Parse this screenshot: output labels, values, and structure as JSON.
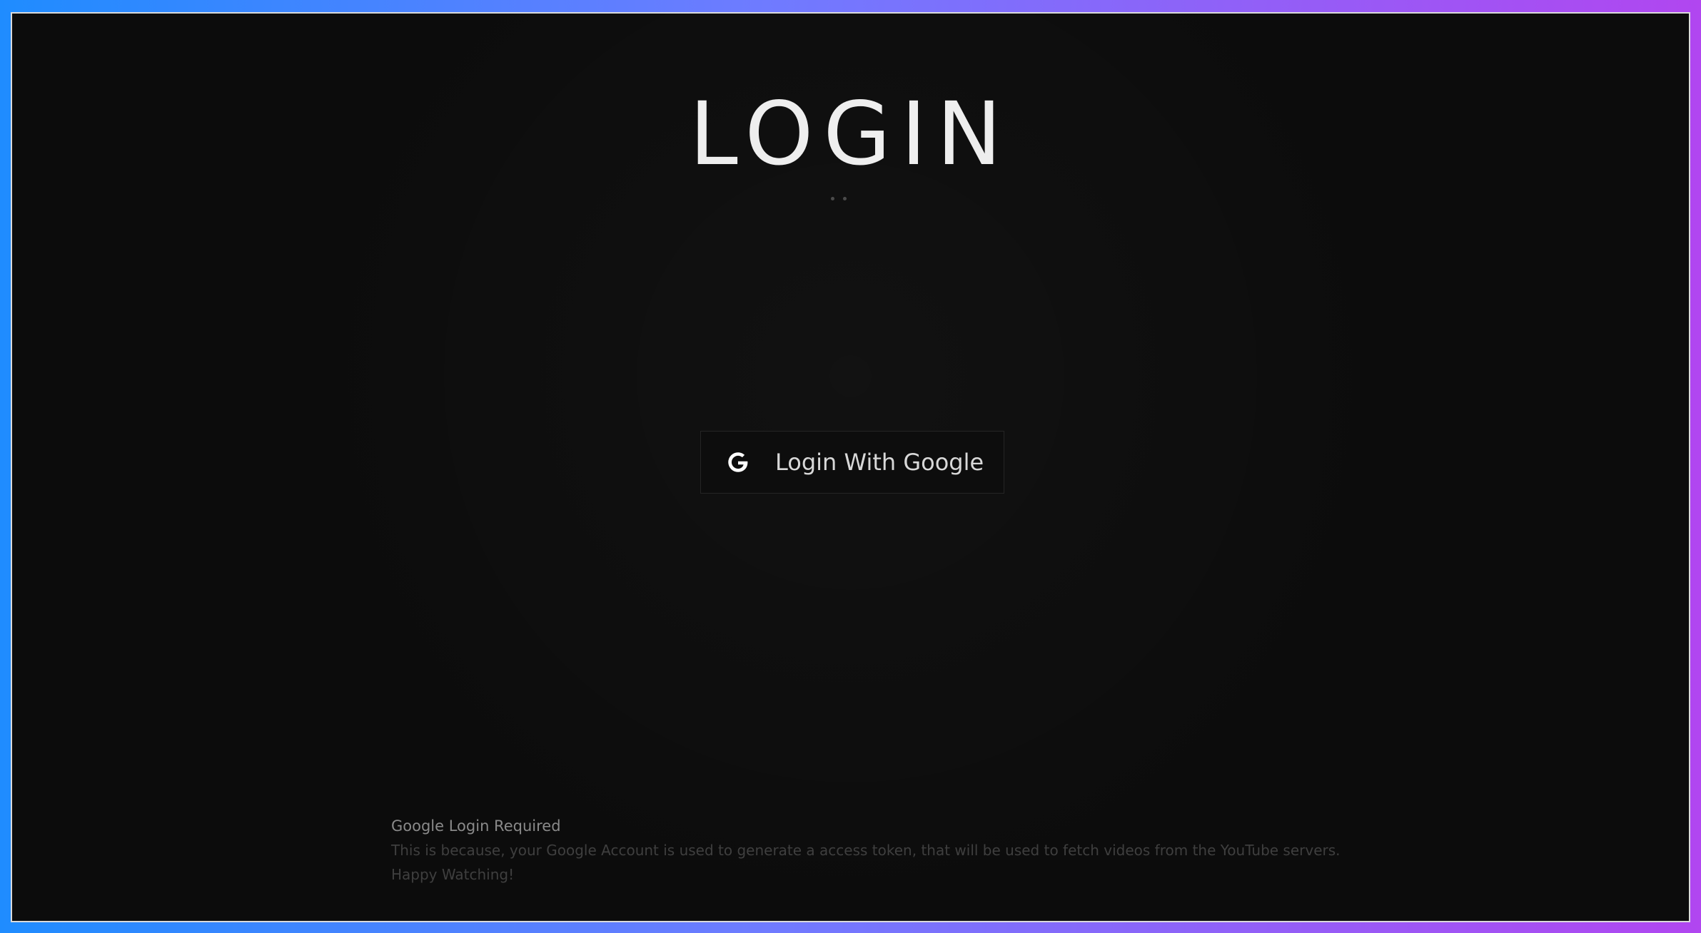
{
  "page": {
    "title": "LOGIN"
  },
  "login_button": {
    "label": "Login With Google",
    "icon": "google-g-icon"
  },
  "notice": {
    "heading": "Google Login Required",
    "body": "This is because, your Google Account is used to generate a access token, that will be used to fetch videos from the YouTube servers.",
    "closing": "Happy Watching!"
  },
  "colors": {
    "background": "#0c0c0c",
    "frame_gradient_start": "#1f8cff",
    "frame_gradient_end": "#b146f0",
    "title": "#eeeeee"
  }
}
